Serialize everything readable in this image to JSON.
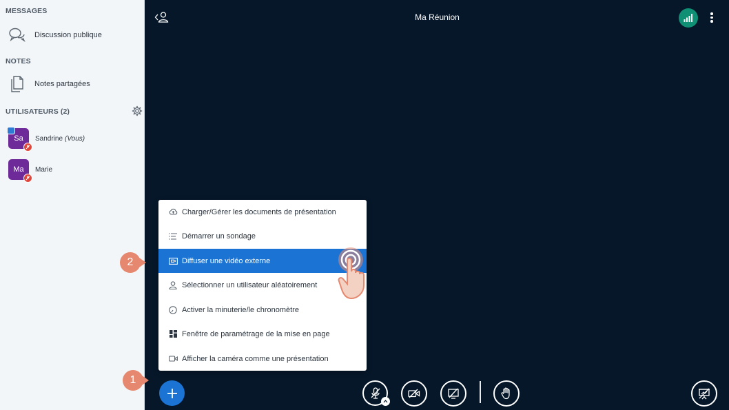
{
  "sidebar": {
    "messages_title": "MESSAGES",
    "public_chat_label": "Discussion publique",
    "notes_title": "NOTES",
    "shared_notes_label": "Notes partagées",
    "users_title": "UTILISATEURS (2)",
    "users": [
      {
        "initials": "Sa",
        "name": "Sandrine",
        "tag": "(Vous)"
      },
      {
        "initials": "Ma",
        "name": "Marie",
        "tag": ""
      }
    ]
  },
  "header": {
    "title": "Ma Réunion"
  },
  "actions_menu": {
    "items": [
      {
        "label": "Charger/Gérer les documents de présentation",
        "icon": "upload-cloud-icon"
      },
      {
        "label": "Démarrer un sondage",
        "icon": "poll-list-icon"
      },
      {
        "label": "Diffuser une vidéo externe",
        "icon": "external-video-icon",
        "active": true
      },
      {
        "label": "Sélectionner un utilisateur aléatoirement",
        "icon": "user-icon"
      },
      {
        "label": "Activer la minuterie/le chronomètre",
        "icon": "timer-icon"
      },
      {
        "label": "Fenêtre de paramétrage de la mise en page",
        "icon": "layout-grid-icon"
      },
      {
        "label": "Afficher la caméra comme une présentation",
        "icon": "camera-icon"
      }
    ]
  },
  "annotations": {
    "step1": "1",
    "step2": "2"
  },
  "colors": {
    "accent": "#1b74d4",
    "background": "#06172a",
    "avatar": "#6f2a9a",
    "step_badge": "#e6886f",
    "connection": "#0f8f74",
    "muted_badge": "#e0463b"
  }
}
